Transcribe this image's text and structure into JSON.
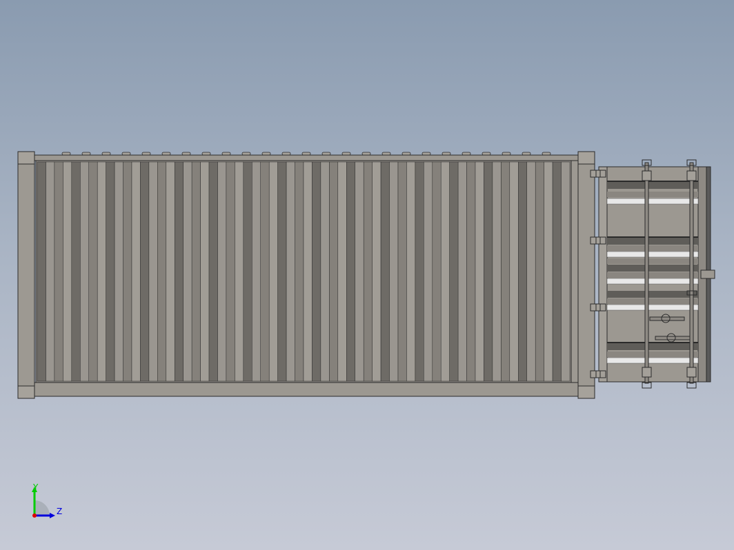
{
  "view": {
    "background_top": "#8a9bb0",
    "background_bottom": "#c6cad6",
    "model_color": "#9a9690",
    "edge_color": "#2a2a2a"
  },
  "triad": {
    "y_label": "Y",
    "z_label": "Z",
    "y_color": "#00cc00",
    "z_color": "#0000dd",
    "origin_color": "#dd0000"
  },
  "container": {
    "corrugation_count": 62,
    "roof_bump_count": 25,
    "door_hinge_count": 4
  }
}
